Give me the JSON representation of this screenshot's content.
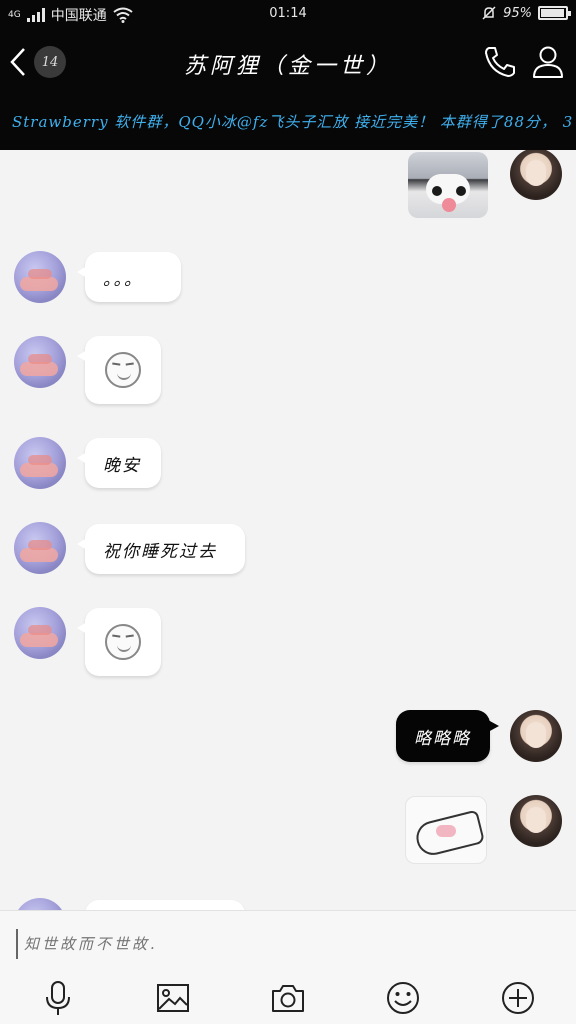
{
  "status_bar": {
    "network": "4G",
    "carrier": "中国联通",
    "time": "01:14",
    "battery": "95%",
    "battery_level": 0.95
  },
  "nav": {
    "unread_count": "14",
    "title": "苏阿狸（金一世）"
  },
  "announcement": {
    "text": "Strawberry 软件群，QQ小冰@fz飞头子汇放 接近完美！ 本群得了88分， 3"
  },
  "messages": [
    {
      "side": "right",
      "type": "sticker",
      "sticker": "husky-dog-sticker"
    },
    {
      "side": "left",
      "type": "text",
      "text": "。。。"
    },
    {
      "side": "left",
      "type": "emoji",
      "emoji": "smug-face-emoji"
    },
    {
      "side": "left",
      "type": "text",
      "text": "晚安"
    },
    {
      "side": "left",
      "type": "text",
      "text": "祝你睡死过去"
    },
    {
      "side": "left",
      "type": "emoji",
      "emoji": "smug-face-emoji"
    },
    {
      "side": "right",
      "type": "text",
      "text": "略略略"
    },
    {
      "side": "right",
      "type": "sticker",
      "sticker": "cat-sticker"
    }
  ],
  "input": {
    "placeholder": "知世故而不世故."
  },
  "toolbar": {
    "icons": [
      "microphone-icon",
      "image-icon",
      "camera-icon",
      "emoji-icon",
      "plus-icon"
    ]
  },
  "colors": {
    "header_bg": "#070707",
    "announcement_text": "#3fb0ee",
    "chat_bg": "#f3f3f3",
    "bubble_white": "#ffffff",
    "bubble_dark": "#050505"
  }
}
